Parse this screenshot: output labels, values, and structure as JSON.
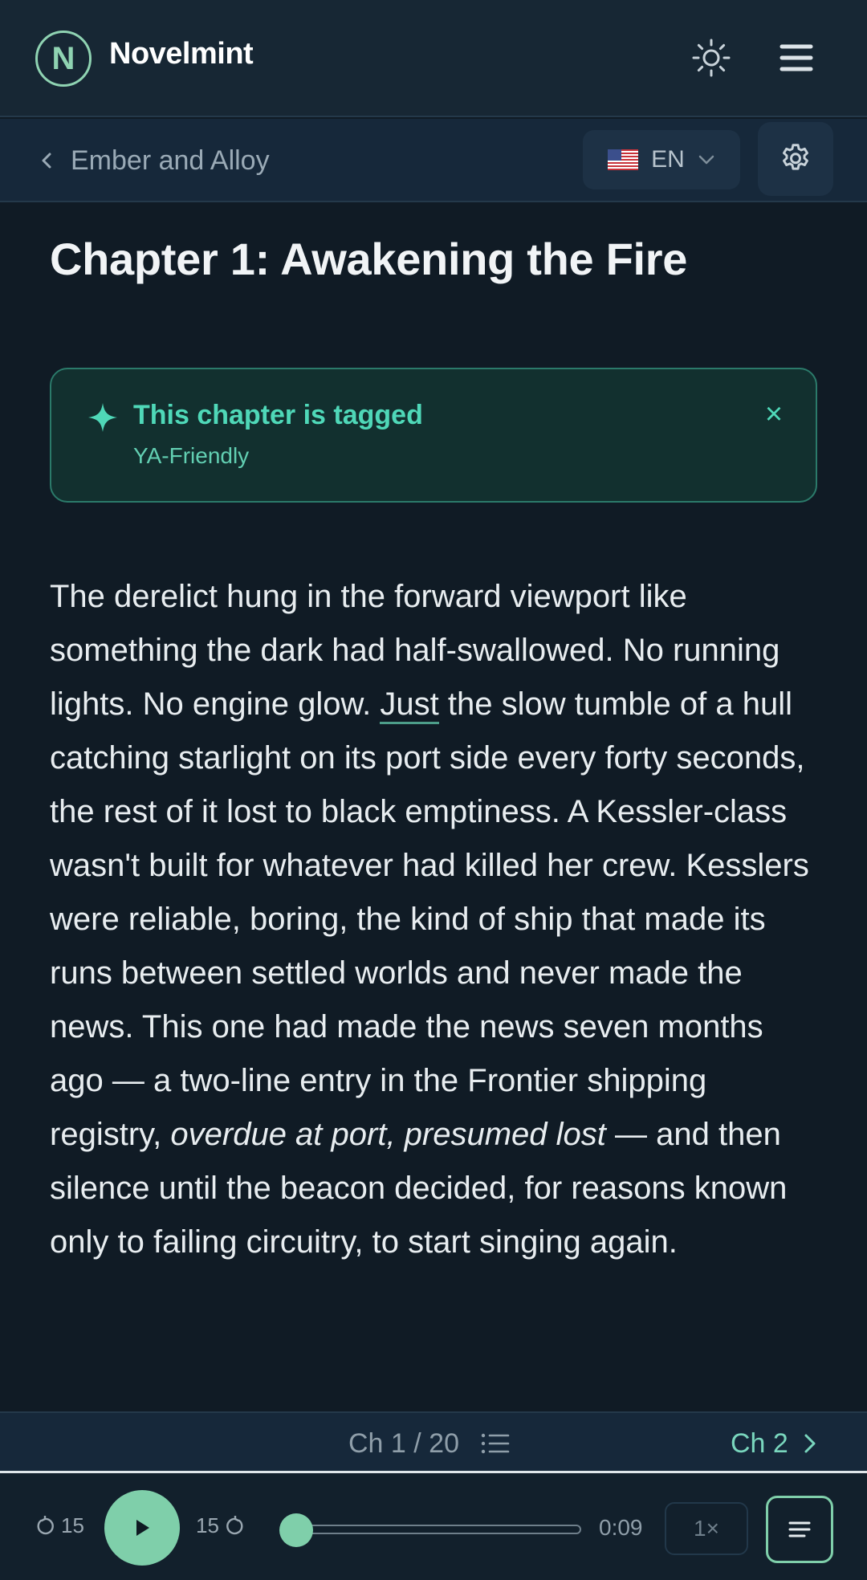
{
  "header": {
    "brand": "Novelmint",
    "logo_letter": "N",
    "icons": {
      "theme": "sun-icon",
      "menu": "hamburger-menu-icon"
    }
  },
  "subbar": {
    "back_label": "Ember and Alloy",
    "language": "EN",
    "language_flag": "us-flag-icon",
    "settings_icon": "gear-icon"
  },
  "chapter": {
    "title": "Chapter 1: Awakening the Fire",
    "tag_notice": {
      "title": "This chapter is tagged",
      "tag": "YA-Friendly",
      "close_glyph": "×"
    },
    "body": {
      "p1": "The derelict hung in the forward viewport like something the dark had half-swallowed. No running lights. No engine glow. ",
      "highlight": "Just",
      "p2": " the slow tumble of a hull catching starlight on its port side every forty seconds, the rest of it lost to black emptiness. A Kessler-class wasn't built for whatever had killed her crew. Kesslers were reliable, boring, the kind of ship that made its runs between settled worlds and never made the news. This one had made the news seven months ago — a two-line entry in the Frontier shipping registry, ",
      "italic": "overdue at port, presumed lost",
      "p3": " — and then silence until the beacon decided, for reasons known only to failing circuitry, to start singing again."
    }
  },
  "chapter_nav": {
    "position": "Ch 1 / 20",
    "next_label": "Ch 2"
  },
  "audio": {
    "rewind_seconds": "15",
    "forward_seconds": "15",
    "time": "0:09",
    "speed": "1×",
    "progress": 0.0
  },
  "colors": {
    "accent": "#7fcfaa",
    "tag_accent": "#4fd8b8",
    "background": "#101b25"
  }
}
